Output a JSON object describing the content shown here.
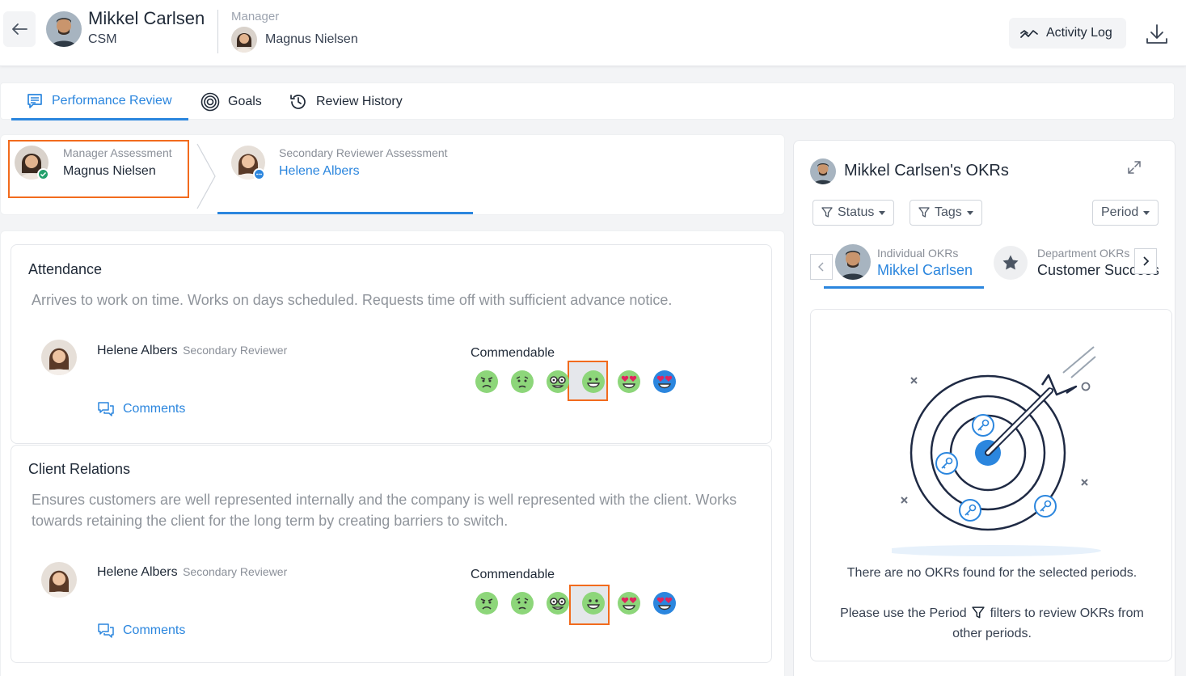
{
  "header": {
    "employee_name": "Mikkel Carlsen",
    "employee_role": "CSM",
    "manager_label": "Manager",
    "manager_name": "Magnus Nielsen",
    "activity_log_label": "Activity Log"
  },
  "tabs": [
    {
      "label": "Performance Review",
      "active": true,
      "icon": "review-icon"
    },
    {
      "label": "Goals",
      "active": false,
      "icon": "target-icon"
    },
    {
      "label": "Review History",
      "active": false,
      "icon": "history-icon"
    }
  ],
  "assessments": [
    {
      "label": "Manager Assessment",
      "name": "Magnus Nielsen",
      "status": "completed",
      "highlighted": true
    },
    {
      "label": "Secondary Reviewer Assessment",
      "name": "Helene Albers",
      "status": "in-progress",
      "active": true
    }
  ],
  "rating_scale": [
    "angry-face",
    "sad-face",
    "nerd-face",
    "smiling-face",
    "heart-eyes-face",
    "blue-heart-eyes-face"
  ],
  "criteria": [
    {
      "title": "Attendance",
      "description": "Arrives to work on time. Works on days scheduled. Requests time off with sufficient advance notice.",
      "reviewer_name": "Helene Albers",
      "reviewer_role": "Secondary Reviewer",
      "rating_label": "Commendable",
      "selected_index": 3,
      "comments_label": "Comments"
    },
    {
      "title": "Client Relations",
      "description": "Ensures customers are well represented internally and the company is well represented with the client. Works towards retaining the client for the long term by creating barriers to switch.",
      "reviewer_name": "Helene Albers",
      "reviewer_role": "Secondary Reviewer",
      "rating_label": "Commendable",
      "selected_index": 3,
      "comments_label": "Comments"
    }
  ],
  "okr_panel": {
    "title": "Mikkel Carlsen's OKRs",
    "filters": {
      "status": "Status",
      "tags": "Tags",
      "period": "Period"
    },
    "okr_tabs": [
      {
        "label": "Individual OKRs",
        "name": "Mikkel Carlsen",
        "active": true
      },
      {
        "label": "Department OKRs",
        "name": "Customer Success",
        "active": false
      }
    ],
    "empty_message": "There are no OKRs found for the selected periods.",
    "hint_before": "Please use the Period",
    "hint_after": "filters to review OKRs from",
    "hint_end": "other periods."
  },
  "colors": {
    "accent": "#2b86de",
    "highlight": "#f26b1d",
    "emoji_green": "#8dd67a",
    "emoji_blue": "#2b86de"
  }
}
